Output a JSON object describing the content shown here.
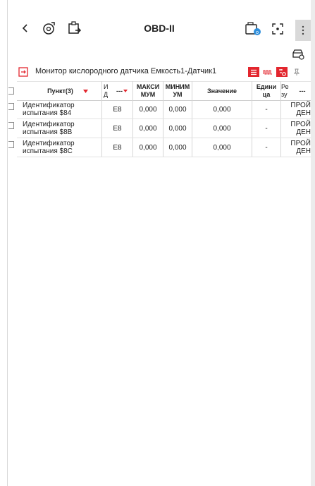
{
  "app": {
    "title": "OBD-II"
  },
  "icons": {
    "back": "chevron-left-icon",
    "diag": "gear-diagnostic-icon",
    "export": "export-icon",
    "snapshot": "camera-icon",
    "fullscreen": "expand-icon",
    "more": "more-vertical-icon",
    "car_settings": "car-settings-icon"
  },
  "section": {
    "label": "Монитор кислородного датчика Емкость1-Датчик1"
  },
  "table": {
    "headers": {
      "item": "Пункт(3)",
      "id_line1": "И",
      "id_line2": "Д",
      "dash": "---",
      "max_line1": "МАКСИ",
      "max_line2": "МУМ",
      "min_line1": "МИНИМ",
      "min_line2": "УМ",
      "value": "Значение",
      "unit_line1": "Едини",
      "unit_line2": "ца",
      "result_line1": "Ре",
      "result_line2": "зу",
      "more": "---"
    },
    "rows": [
      {
        "item": "Идентификатор испытания $84",
        "id": "E8",
        "max": "0,000",
        "min": "0,000",
        "value": "0,000",
        "unit": "-",
        "result_line1": "ПРОЙ",
        "result_line2": "ДЕН"
      },
      {
        "item": "Идентификатор испытания $8B",
        "id": "E8",
        "max": "0,000",
        "min": "0,000",
        "value": "0,000",
        "unit": "-",
        "result_line1": "ПРОЙ",
        "result_line2": "ДЕН"
      },
      {
        "item": "Идентификатор испытания $8C",
        "id": "E8",
        "max": "0,000",
        "min": "0,000",
        "value": "0,000",
        "unit": "-",
        "result_line1": "ПРОЙ",
        "result_line2": "ДЕН"
      }
    ]
  },
  "colors": {
    "accent": "#e3262e",
    "text": "#222222",
    "gray": "#d9d9d9"
  }
}
